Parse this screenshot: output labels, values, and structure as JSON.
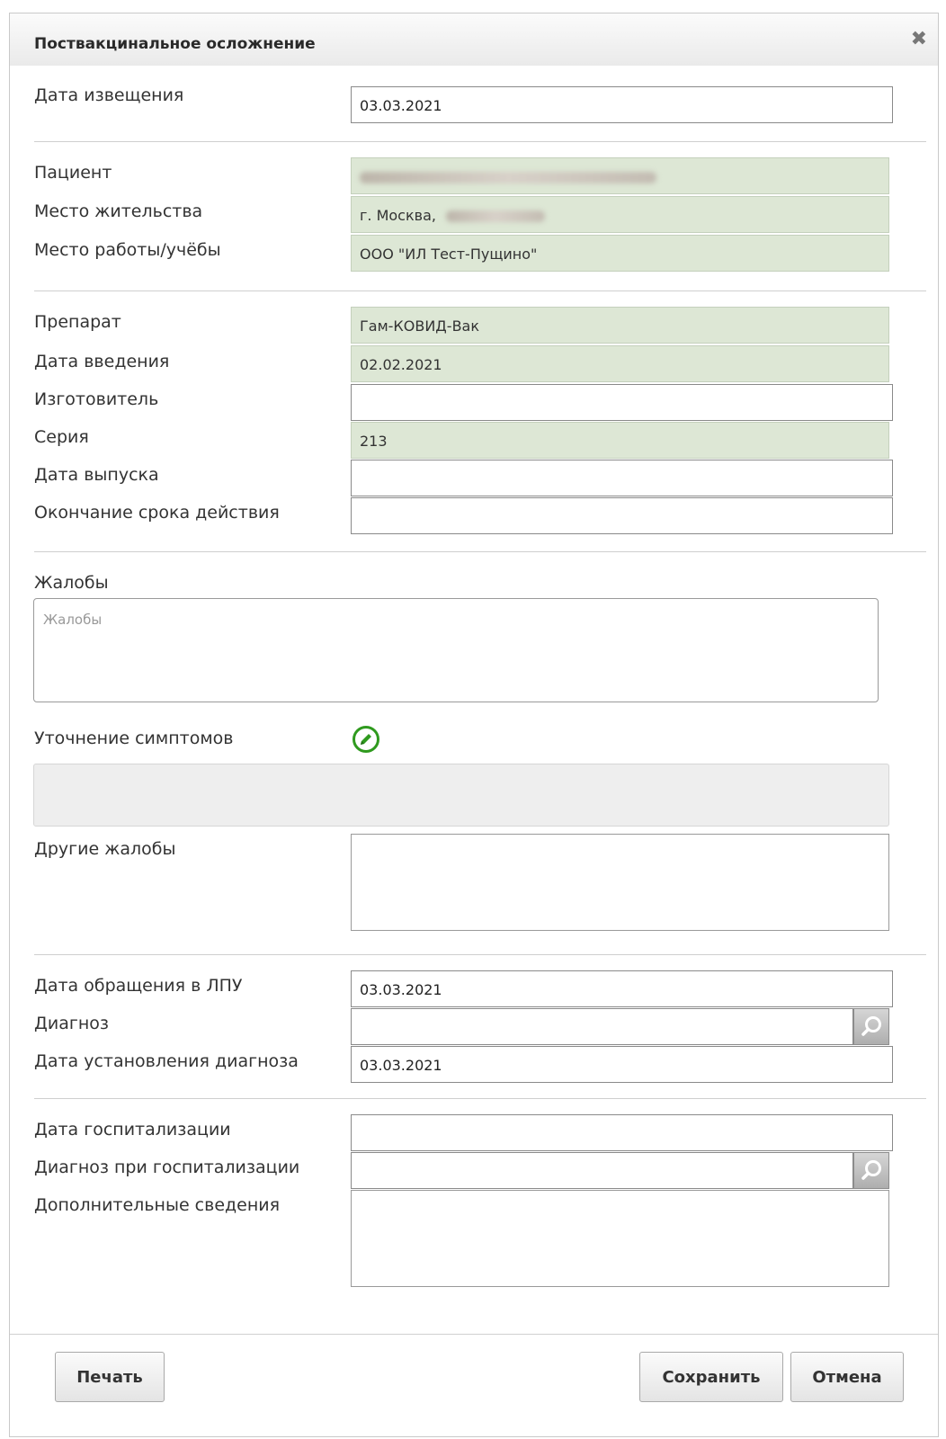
{
  "dialog": {
    "title": "Поствакцинальное осложнение"
  },
  "notice_date": {
    "label": "Дата извещения",
    "value": "03.03.2021"
  },
  "patient": {
    "label": "Пациент",
    "value": "",
    "residence_label": "Место жительства",
    "residence_value": "г. Москва,",
    "work_label": "Место работы/учёбы",
    "work_value": "ООО \"ИЛ Тест-Пущино\""
  },
  "vaccine": {
    "drug_label": "Препарат",
    "drug_value": "Гам-КОВИД-Вак",
    "admin_date_label": "Дата введения",
    "admin_date_value": "02.02.2021",
    "manufacturer_label": "Изготовитель",
    "manufacturer_value": "",
    "series_label": "Серия",
    "series_value": "213",
    "release_date_label": "Дата выпуска",
    "release_date_value": "",
    "expiry_label": "Окончание срока действия",
    "expiry_value": ""
  },
  "complaints": {
    "label": "Жалобы",
    "placeholder": "Жалобы",
    "symptoms_label": "Уточнение симптомов",
    "other_label": "Другие жалобы"
  },
  "visit": {
    "date_label": "Дата обращения в ЛПУ",
    "date_value": "03.03.2021",
    "diagnosis_label": "Диагноз",
    "diagnosis_value": "",
    "diagnosis_date_label": "Дата установления диагноза",
    "diagnosis_date_value": "03.03.2021"
  },
  "hospital": {
    "date_label": "Дата госпитализации",
    "date_value": "",
    "diagnosis_label": "Диагноз при госпитализации",
    "diagnosis_value": "",
    "extra_label": "Дополнительные сведения"
  },
  "buttons": {
    "print": "Печать",
    "save": "Сохранить",
    "cancel": "Отмена"
  },
  "icons": {
    "close": "close-icon",
    "edit": "edit-pencil-icon",
    "search": "search-icon"
  },
  "colors": {
    "readonly_bg": "#dde7d5",
    "edit_icon": "#2f9a1e"
  }
}
